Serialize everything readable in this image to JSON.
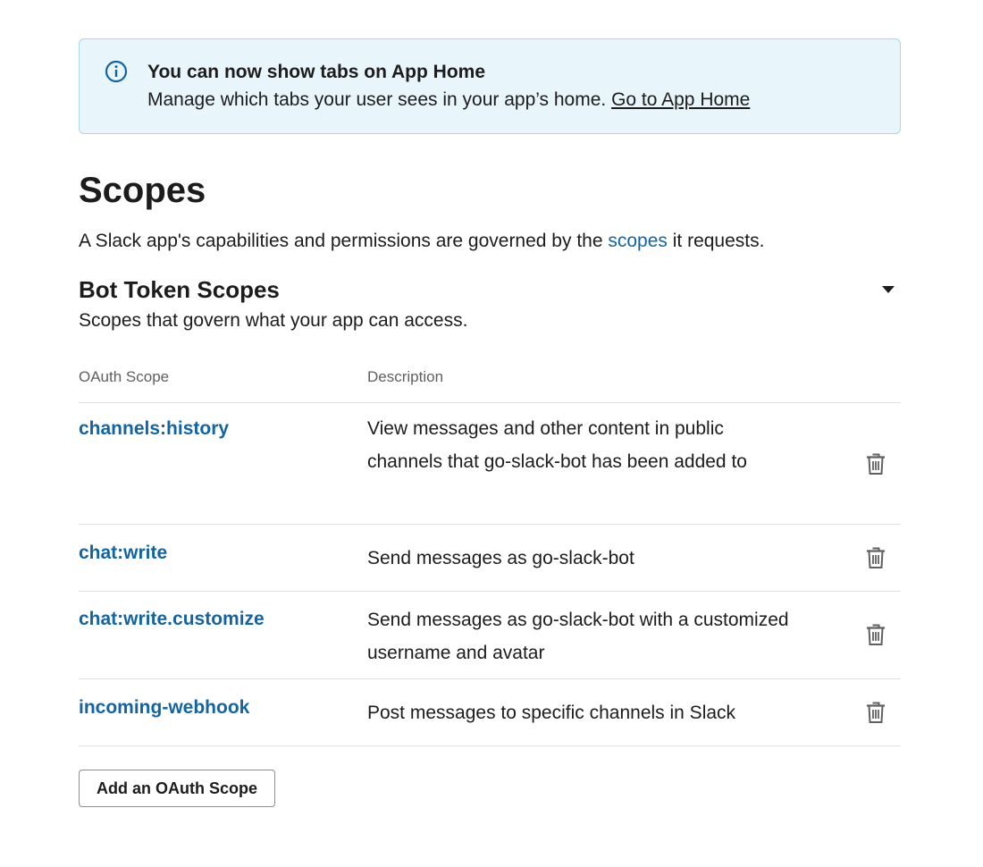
{
  "banner": {
    "title": "You can now show tabs on App Home",
    "body": "Manage which tabs your user sees in your app’s home. ",
    "link": "Go to App Home"
  },
  "page": {
    "title": "Scopes",
    "intro_before": "A Slack app's capabilities and permissions are governed by the ",
    "intro_link": "scopes",
    "intro_after": " it requests."
  },
  "section": {
    "title": "Bot Token Scopes",
    "subtitle": "Scopes that govern what your app can access."
  },
  "table": {
    "headers": {
      "scope": "OAuth Scope",
      "description": "Description"
    },
    "rows": [
      {
        "scope": "channels:history",
        "description": "View messages and other content in public channels that go-slack-bot has been added to"
      },
      {
        "scope": "chat:write",
        "description": "Send messages as go-slack-bot"
      },
      {
        "scope": "chat:write.customize",
        "description": "Send messages as go-slack-bot with a customized username and avatar"
      },
      {
        "scope": "incoming-webhook",
        "description": "Post messages to specific channels in Slack"
      }
    ]
  },
  "actions": {
    "add_scope": "Add an OAuth Scope"
  },
  "colors": {
    "link": "#1264a3",
    "banner_bg": "#e8f5fa",
    "banner_border": "#a9d8ea",
    "info_icon": "#1264a3"
  },
  "icons": {
    "info": "info-icon",
    "caret": "caret-down-icon",
    "delete": "trash-icon"
  }
}
